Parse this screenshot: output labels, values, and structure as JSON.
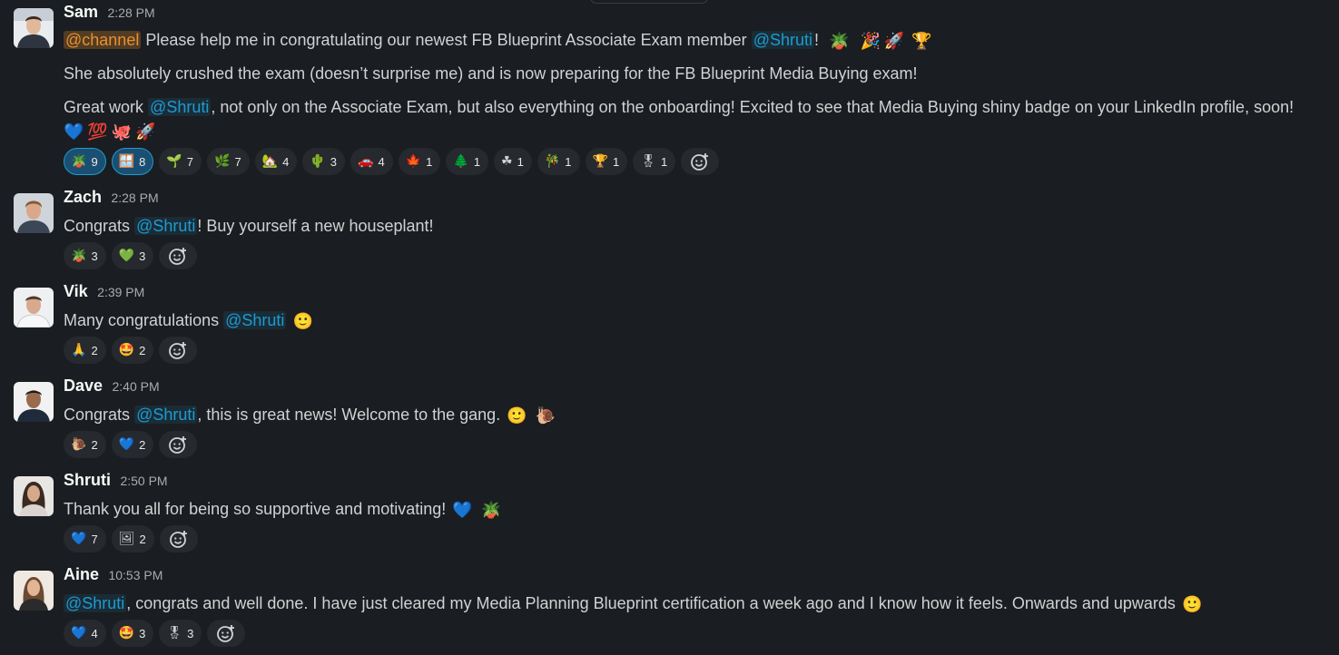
{
  "messages": [
    {
      "author": "Sam",
      "time": "2:28 PM",
      "channel_tag": "@channel",
      "line1": {
        "pre": "Please help me in congratulating our newest FB Blueprint Associate Exam member",
        "mention": "@Shruti",
        "post": "!"
      },
      "line1_emojis": [
        "🪴",
        "🎉",
        "🚀",
        "🏆"
      ],
      "line2": "She absolutely crushed the exam (doesn’t surprise me) and is now preparing for the FB Blueprint Media Buying exam!",
      "line3": {
        "pre": "Great work",
        "mention": "@Shruti",
        "post": ", not only on the Associate Exam, but also everything on the onboarding! Excited to see that Media Buying shiny badge on your LinkedIn profile, soon!"
      },
      "line4_emojis": [
        "💙",
        "💯",
        "🐙",
        "🚀"
      ],
      "reactions": [
        {
          "icon": "🪴",
          "count": "9",
          "active": true
        },
        {
          "icon": "🪟",
          "count": "8",
          "active": true
        },
        {
          "icon": "🌱",
          "count": "7"
        },
        {
          "icon": "🌿",
          "count": "7"
        },
        {
          "icon": "🏡",
          "count": "4"
        },
        {
          "icon": "🌵",
          "count": "3"
        },
        {
          "icon": "🚗",
          "count": "4"
        },
        {
          "icon": "🍁",
          "count": "1"
        },
        {
          "icon": "🌲",
          "count": "1"
        },
        {
          "icon": "☘",
          "count": "1"
        },
        {
          "icon": "🎋",
          "count": "1"
        },
        {
          "icon": "🏆",
          "count": "1"
        },
        {
          "icon": "🎖",
          "count": "1"
        }
      ]
    },
    {
      "author": "Zach",
      "time": "2:28 PM",
      "text_pre": "Congrats",
      "mention": "@Shruti",
      "text_post": "! Buy yourself a new houseplant!",
      "reactions": [
        {
          "icon": "🪴",
          "count": "3"
        },
        {
          "icon": "💚",
          "count": "3"
        }
      ]
    },
    {
      "author": "Vik",
      "time": "2:39 PM",
      "text_pre": "Many congratulations",
      "mention": "@Shruti",
      "emoji": "🙂",
      "reactions": [
        {
          "icon": "🙏",
          "count": "2"
        },
        {
          "icon": "🤩",
          "count": "2"
        }
      ]
    },
    {
      "author": "Dave",
      "time": "2:40 PM",
      "text_pre": "Congrats",
      "mention": "@Shruti",
      "text_post": ", this is great news! Welcome to the gang.",
      "emojis": [
        "🙂",
        "🐌"
      ],
      "reactions": [
        {
          "icon": "🐌",
          "count": "2"
        },
        {
          "icon": "💙",
          "count": "2"
        }
      ]
    },
    {
      "author": "Shruti",
      "time": "2:50 PM",
      "text": "Thank you all for being so supportive and motivating!",
      "emojis": [
        "💙",
        "🪴"
      ],
      "reactions": [
        {
          "icon": "💙",
          "count": "7"
        },
        {
          "icon": "🖼",
          "count": "2"
        }
      ]
    },
    {
      "author": "Aine",
      "time": "10:53 PM",
      "mention": "@Shruti",
      "text_post": ", congrats and well done. I have just cleared my Media Planning Blueprint certification a week ago and I know how it feels. Onwards and upwards",
      "emoji": "🙂",
      "reactions": [
        {
          "icon": "💙",
          "count": "4"
        },
        {
          "icon": "🤩",
          "count": "3"
        },
        {
          "icon": "🎖",
          "count": "3"
        }
      ]
    }
  ],
  "add_reaction_icon": "add-reaction-icon"
}
